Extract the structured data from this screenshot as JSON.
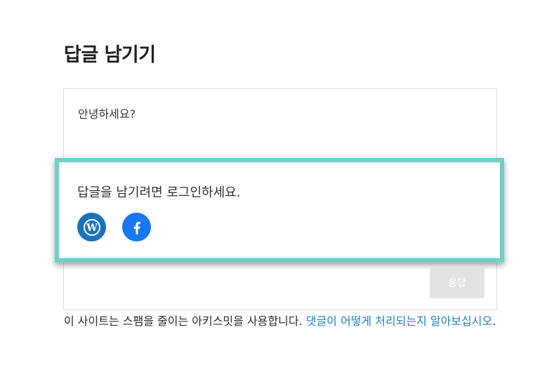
{
  "page": {
    "title": "답글 남기기"
  },
  "comment": {
    "text": "안녕하세요?"
  },
  "login_prompt": {
    "text": "답글을 남기려면 로그인하세요.",
    "icons": [
      "wordpress-icon",
      "facebook-icon"
    ]
  },
  "actions": {
    "reply_label": "응답"
  },
  "notice": {
    "text": "이 사이트는 스팸을 줄이는 아키스밋을 사용합니다. ",
    "link_text": "댓글이 어떻게 처리되는지 알아보십시오",
    "suffix": "."
  },
  "colors": {
    "highlight": "#6fd0c9",
    "wordpress": "#1a73b9",
    "facebook": "#1877f2",
    "link": "#1f7fbf"
  }
}
